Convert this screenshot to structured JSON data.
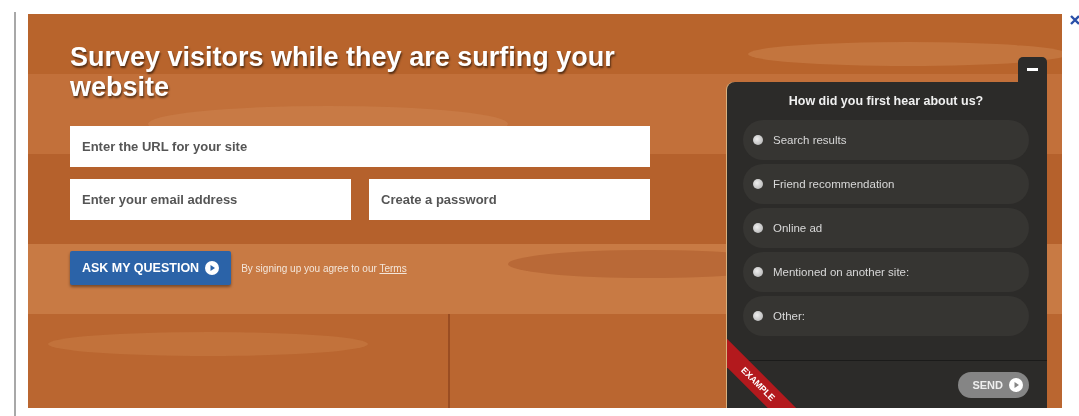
{
  "hero": {
    "title": "Survey visitors while they are surfing your website"
  },
  "signup_form": {
    "fields": [
      {
        "placeholder": "Enter the URL for your site"
      },
      {
        "placeholder": "Enter your email address"
      },
      {
        "placeholder": "Create a password"
      }
    ],
    "submit_button": "ASK MY QUESTION",
    "notice": "By signing up you agree to our",
    "terms_link": "Terms"
  },
  "survey_widget": {
    "question": "How did you first hear about us?",
    "options": [
      {
        "label": "Search results",
        "selected": false
      },
      {
        "label": "Friend recommendation",
        "selected": false
      },
      {
        "label": "Online ad",
        "selected": false
      },
      {
        "label": "Mentioned on another site:",
        "selected": false
      },
      {
        "label": "Other:",
        "selected": false
      }
    ],
    "ribbon": "EXAMPLE",
    "send_button": "SEND"
  }
}
